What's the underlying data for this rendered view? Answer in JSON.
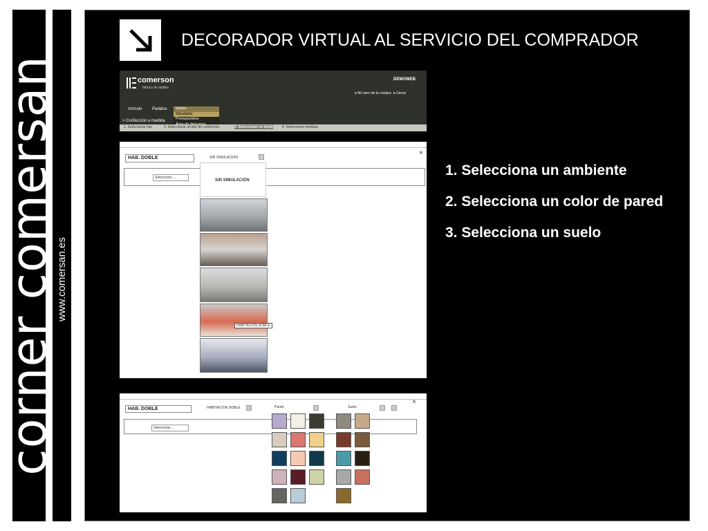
{
  "brand": {
    "name": "corner comersan",
    "url": "www.comersan.es"
  },
  "title": "DECORADOR VIRTUAL AL SERVICIO DEL COMPRADOR",
  "steps": [
    "1. Selecciona un ambiente",
    "2. Selecciona un color de pared",
    "3. Selecciona un suelo"
  ],
  "app": {
    "brand_name": "comerson",
    "brand_sub": "fábrica de tejidos",
    "demo": "DEMOWEB",
    "cart_link": "Mi carro de la compra",
    "close_link": "Cerrar",
    "menu": [
      "Artículo",
      "Pedidos"
    ],
    "dropdown": [
      "Varios",
      "Simulador",
      "Presupuestos",
      "Área de descarga"
    ],
    "crumb": "> Confección a medida",
    "step_labels": [
      "1. Seleccionar tipo",
      "2. Seleccionar un tipo de confección",
      "3. Seleccionar un tejido",
      "4. Seleccionar medidas"
    ]
  },
  "sim": {
    "room_field": "HAB. DOBLE",
    "select_placeholder": "Seleccione ...",
    "sim_label": "SIN SIMULACION",
    "sim_option": "SIN SIMULACIÓN",
    "tooltip": "HABITACION DOBLE",
    "close": "×"
  },
  "colors": {
    "room_field": "HAB. DOBLE",
    "room_label": "HABITACION DOBLE",
    "select_placeholder": "Seleccione ...",
    "wall_label": "Pared",
    "floor_label": "Suelo",
    "close": "×",
    "wall_swatches": [
      "#b8a9cf",
      "#f5f0e6",
      "#3c3c34",
      "#d8ccc0",
      "#d97770",
      "#f0d088",
      "#0f3e60",
      "#f5cab2",
      "#123a48",
      "#cdb3b8",
      "#5a1c26",
      "#cfd4a8",
      "#656561",
      "#b8cbd8"
    ],
    "floor_swatches": [
      "#908a83",
      "#c4a98a",
      "#7a3a2a",
      "#7a5a3a",
      "#4a9aa8",
      "#2a1e14",
      "#a8a8a8",
      "#c87060",
      "#8a6a2a"
    ]
  },
  "icons": {
    "arrow": "arrow-down-right-icon"
  }
}
